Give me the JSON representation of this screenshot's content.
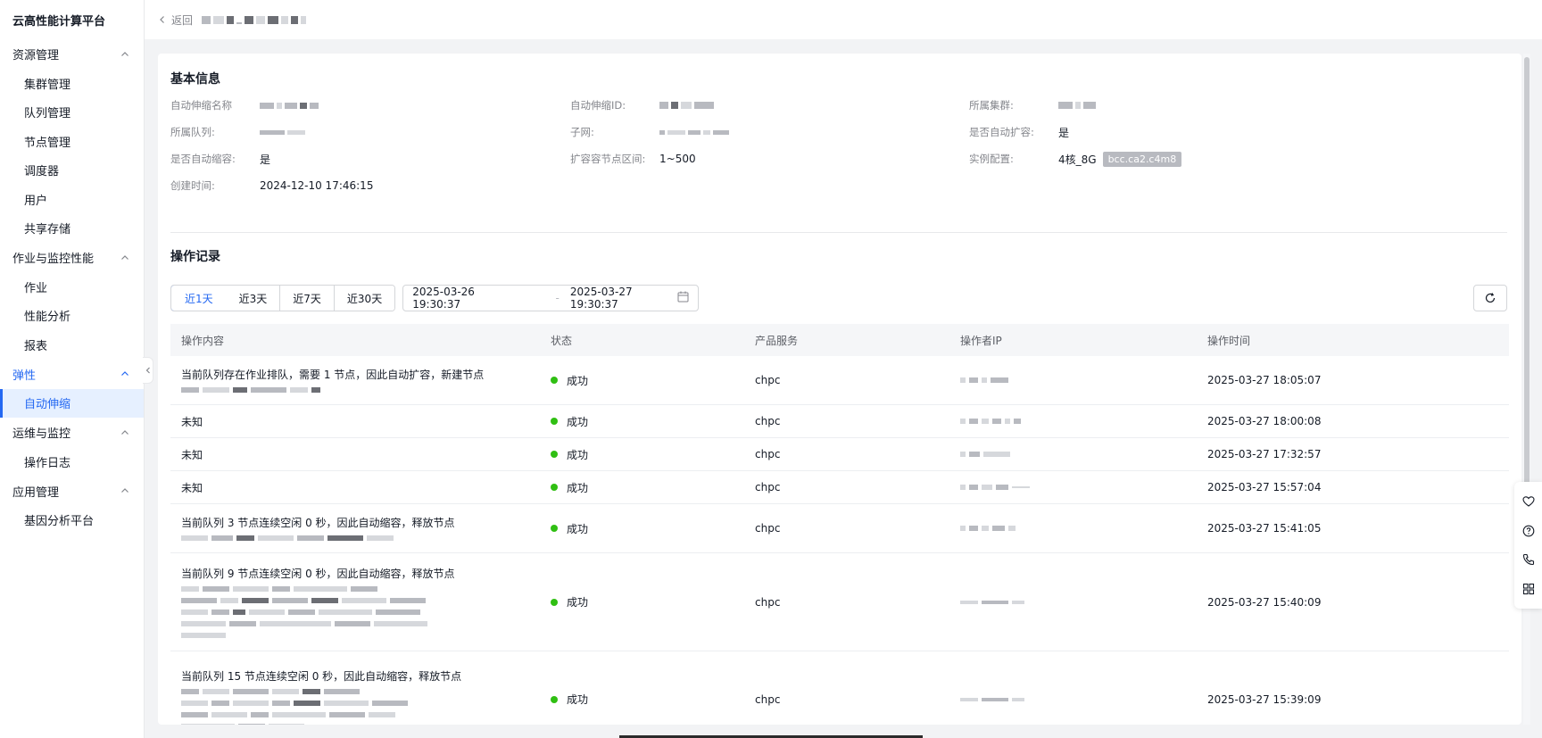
{
  "app": {
    "title": "云高性能计算平台"
  },
  "sidebar": {
    "groups": [
      {
        "label": "资源管理",
        "items": [
          "集群管理",
          "队列管理",
          "节点管理",
          "调度器",
          "用户",
          "共享存储"
        ]
      },
      {
        "label": "作业与监控性能",
        "items": [
          "作业",
          "性能分析",
          "报表"
        ]
      },
      {
        "label": "弹性",
        "items": [
          "自动伸缩"
        ]
      },
      {
        "label": "运维与监控",
        "items": [
          "操作日志"
        ]
      },
      {
        "label": "应用管理",
        "items": [
          "基因分析平台"
        ]
      }
    ]
  },
  "topbar": {
    "back_label": "返回"
  },
  "basic_info": {
    "title": "基本信息",
    "fields": [
      {
        "label": "自动伸缩名称",
        "value": ""
      },
      {
        "label": "自动伸缩ID:",
        "value": ""
      },
      {
        "label": "所属集群:",
        "value": ""
      },
      {
        "label": "所属队列:",
        "value": ""
      },
      {
        "label": "子网:",
        "value": ""
      },
      {
        "label": "是否自动扩容:",
        "value": "是"
      },
      {
        "label": "是否自动缩容:",
        "value": "是"
      },
      {
        "label": "扩容容节点区间:",
        "value": "1~500"
      },
      {
        "label": "实例配置:",
        "value": "4核_8G",
        "tag": "bcc.ca2.c4m8"
      },
      {
        "label": "创建时间:",
        "value": "2024-12-10 17:46:15"
      }
    ]
  },
  "records": {
    "title": "操作记录",
    "ranges": [
      "近1天",
      "近3天",
      "近7天",
      "近30天"
    ],
    "active_range": "近1天",
    "date_start": "2025-03-26 19:30:37",
    "date_end": "2025-03-27 19:30:37",
    "date_separator": "-",
    "columns": [
      "操作内容",
      "状态",
      "产品服务",
      "操作者IP",
      "操作时间"
    ],
    "rows": [
      {
        "content": "当前队列存在作业排队，需要 1 节点，因此自动扩容，新建节点",
        "status": "成功",
        "service": "chpc",
        "time": "2025-03-27 18:05:07"
      },
      {
        "content": "未知",
        "status": "成功",
        "service": "chpc",
        "time": "2025-03-27 18:00:08"
      },
      {
        "content": "未知",
        "status": "成功",
        "service": "chpc",
        "time": "2025-03-27 17:32:57"
      },
      {
        "content": "未知",
        "status": "成功",
        "service": "chpc",
        "time": "2025-03-27 15:57:04"
      },
      {
        "content": "当前队列 3 节点连续空闲 0 秒，因此自动缩容，释放节点",
        "status": "成功",
        "service": "chpc",
        "time": "2025-03-27 15:41:05"
      },
      {
        "content": "当前队列 9 节点连续空闲 0 秒，因此自动缩容，释放节点",
        "status": "成功",
        "service": "chpc",
        "time": "2025-03-27 15:40:09"
      },
      {
        "content": "当前队列 15 节点连续空闲 0 秒，因此自动缩容，释放节点",
        "status": "成功",
        "service": "chpc",
        "time": "2025-03-27 15:39:09"
      }
    ]
  },
  "icons": {
    "back": "chevron-left-icon",
    "calendar": "calendar-icon",
    "refresh": "refresh-icon",
    "float": [
      "heart-icon",
      "help-icon",
      "phone-icon",
      "grid-icon"
    ]
  },
  "colors": {
    "accent": "#2468f2",
    "success": "#30bf13"
  }
}
